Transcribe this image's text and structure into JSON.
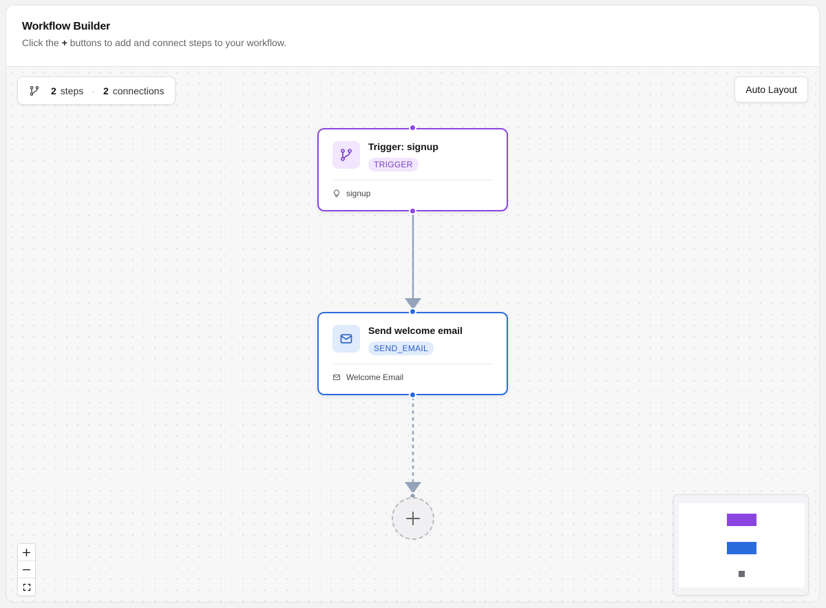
{
  "header": {
    "title": "Workflow Builder",
    "subtitle_pre": "Click the ",
    "subtitle_plus": "+",
    "subtitle_post": " buttons to add and connect steps to your workflow."
  },
  "stats": {
    "steps_count": "2",
    "steps_label": "steps",
    "separator": "·",
    "connections_count": "2",
    "connections_label": "connections",
    "icon": "git-branch-icon"
  },
  "toolbar": {
    "auto_layout_label": "Auto Layout"
  },
  "nodes": [
    {
      "title": "Trigger: signup",
      "badge": "TRIGGER",
      "detail": "signup",
      "icon": "git-branch-icon",
      "detail_icon": "lightbulb-icon",
      "color": "#8b45e0"
    },
    {
      "title": "Send welcome email",
      "badge": "SEND_EMAIL",
      "detail": "Welcome Email",
      "icon": "mail-icon",
      "detail_icon": "mail-icon",
      "color": "#2b6be0"
    }
  ],
  "add_step": {
    "icon": "plus-icon"
  },
  "zoom_controls": {
    "zoom_in_icon": "plus-icon",
    "zoom_out_icon": "minus-icon",
    "fit_view_icon": "fit-view-icon"
  },
  "minimap": {
    "colors": [
      "#8b45e0",
      "#2b6be0",
      "#6b6b75"
    ]
  }
}
